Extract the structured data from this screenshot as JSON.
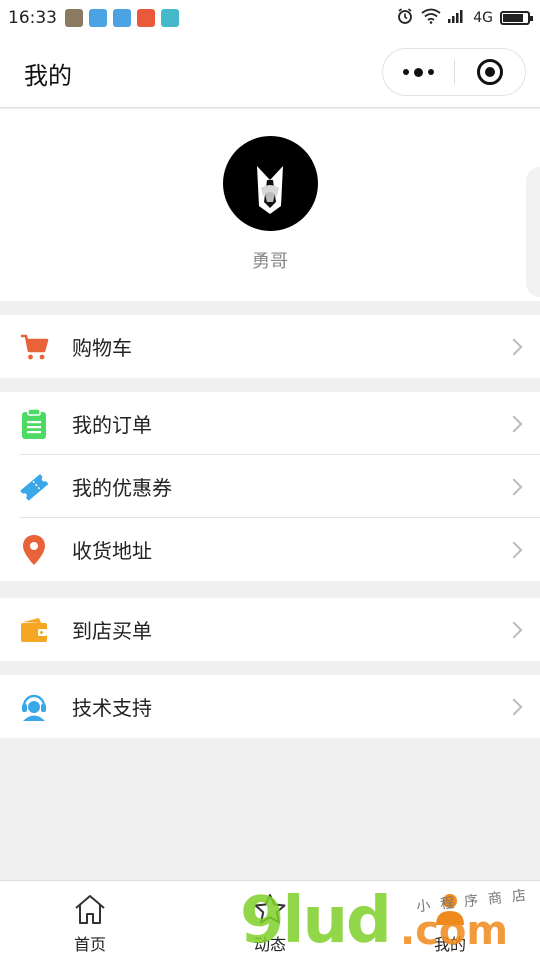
{
  "status_bar": {
    "time": "16:33",
    "network": "4G",
    "battery_level": 0.85
  },
  "nav": {
    "title": "我的"
  },
  "profile": {
    "username": "勇哥"
  },
  "menu": {
    "cart": "购物车",
    "orders": "我的订单",
    "coupons": "我的优惠券",
    "address": "收货地址",
    "in_store_pay": "到店买单",
    "support": "技术支持"
  },
  "tabbar": {
    "home": "首页",
    "feed": "动态",
    "mine": "我的"
  },
  "watermark": {
    "brand": "9lud",
    "suffix": ".com",
    "tagline": "小程序商店"
  },
  "colors": {
    "cart_icon": "#e8633a",
    "orders_icon": "#4cd964",
    "coupons_icon": "#3aa7e8",
    "address_icon": "#e8633a",
    "store_icon": "#f5a623",
    "support_icon": "#3aa7e8"
  }
}
